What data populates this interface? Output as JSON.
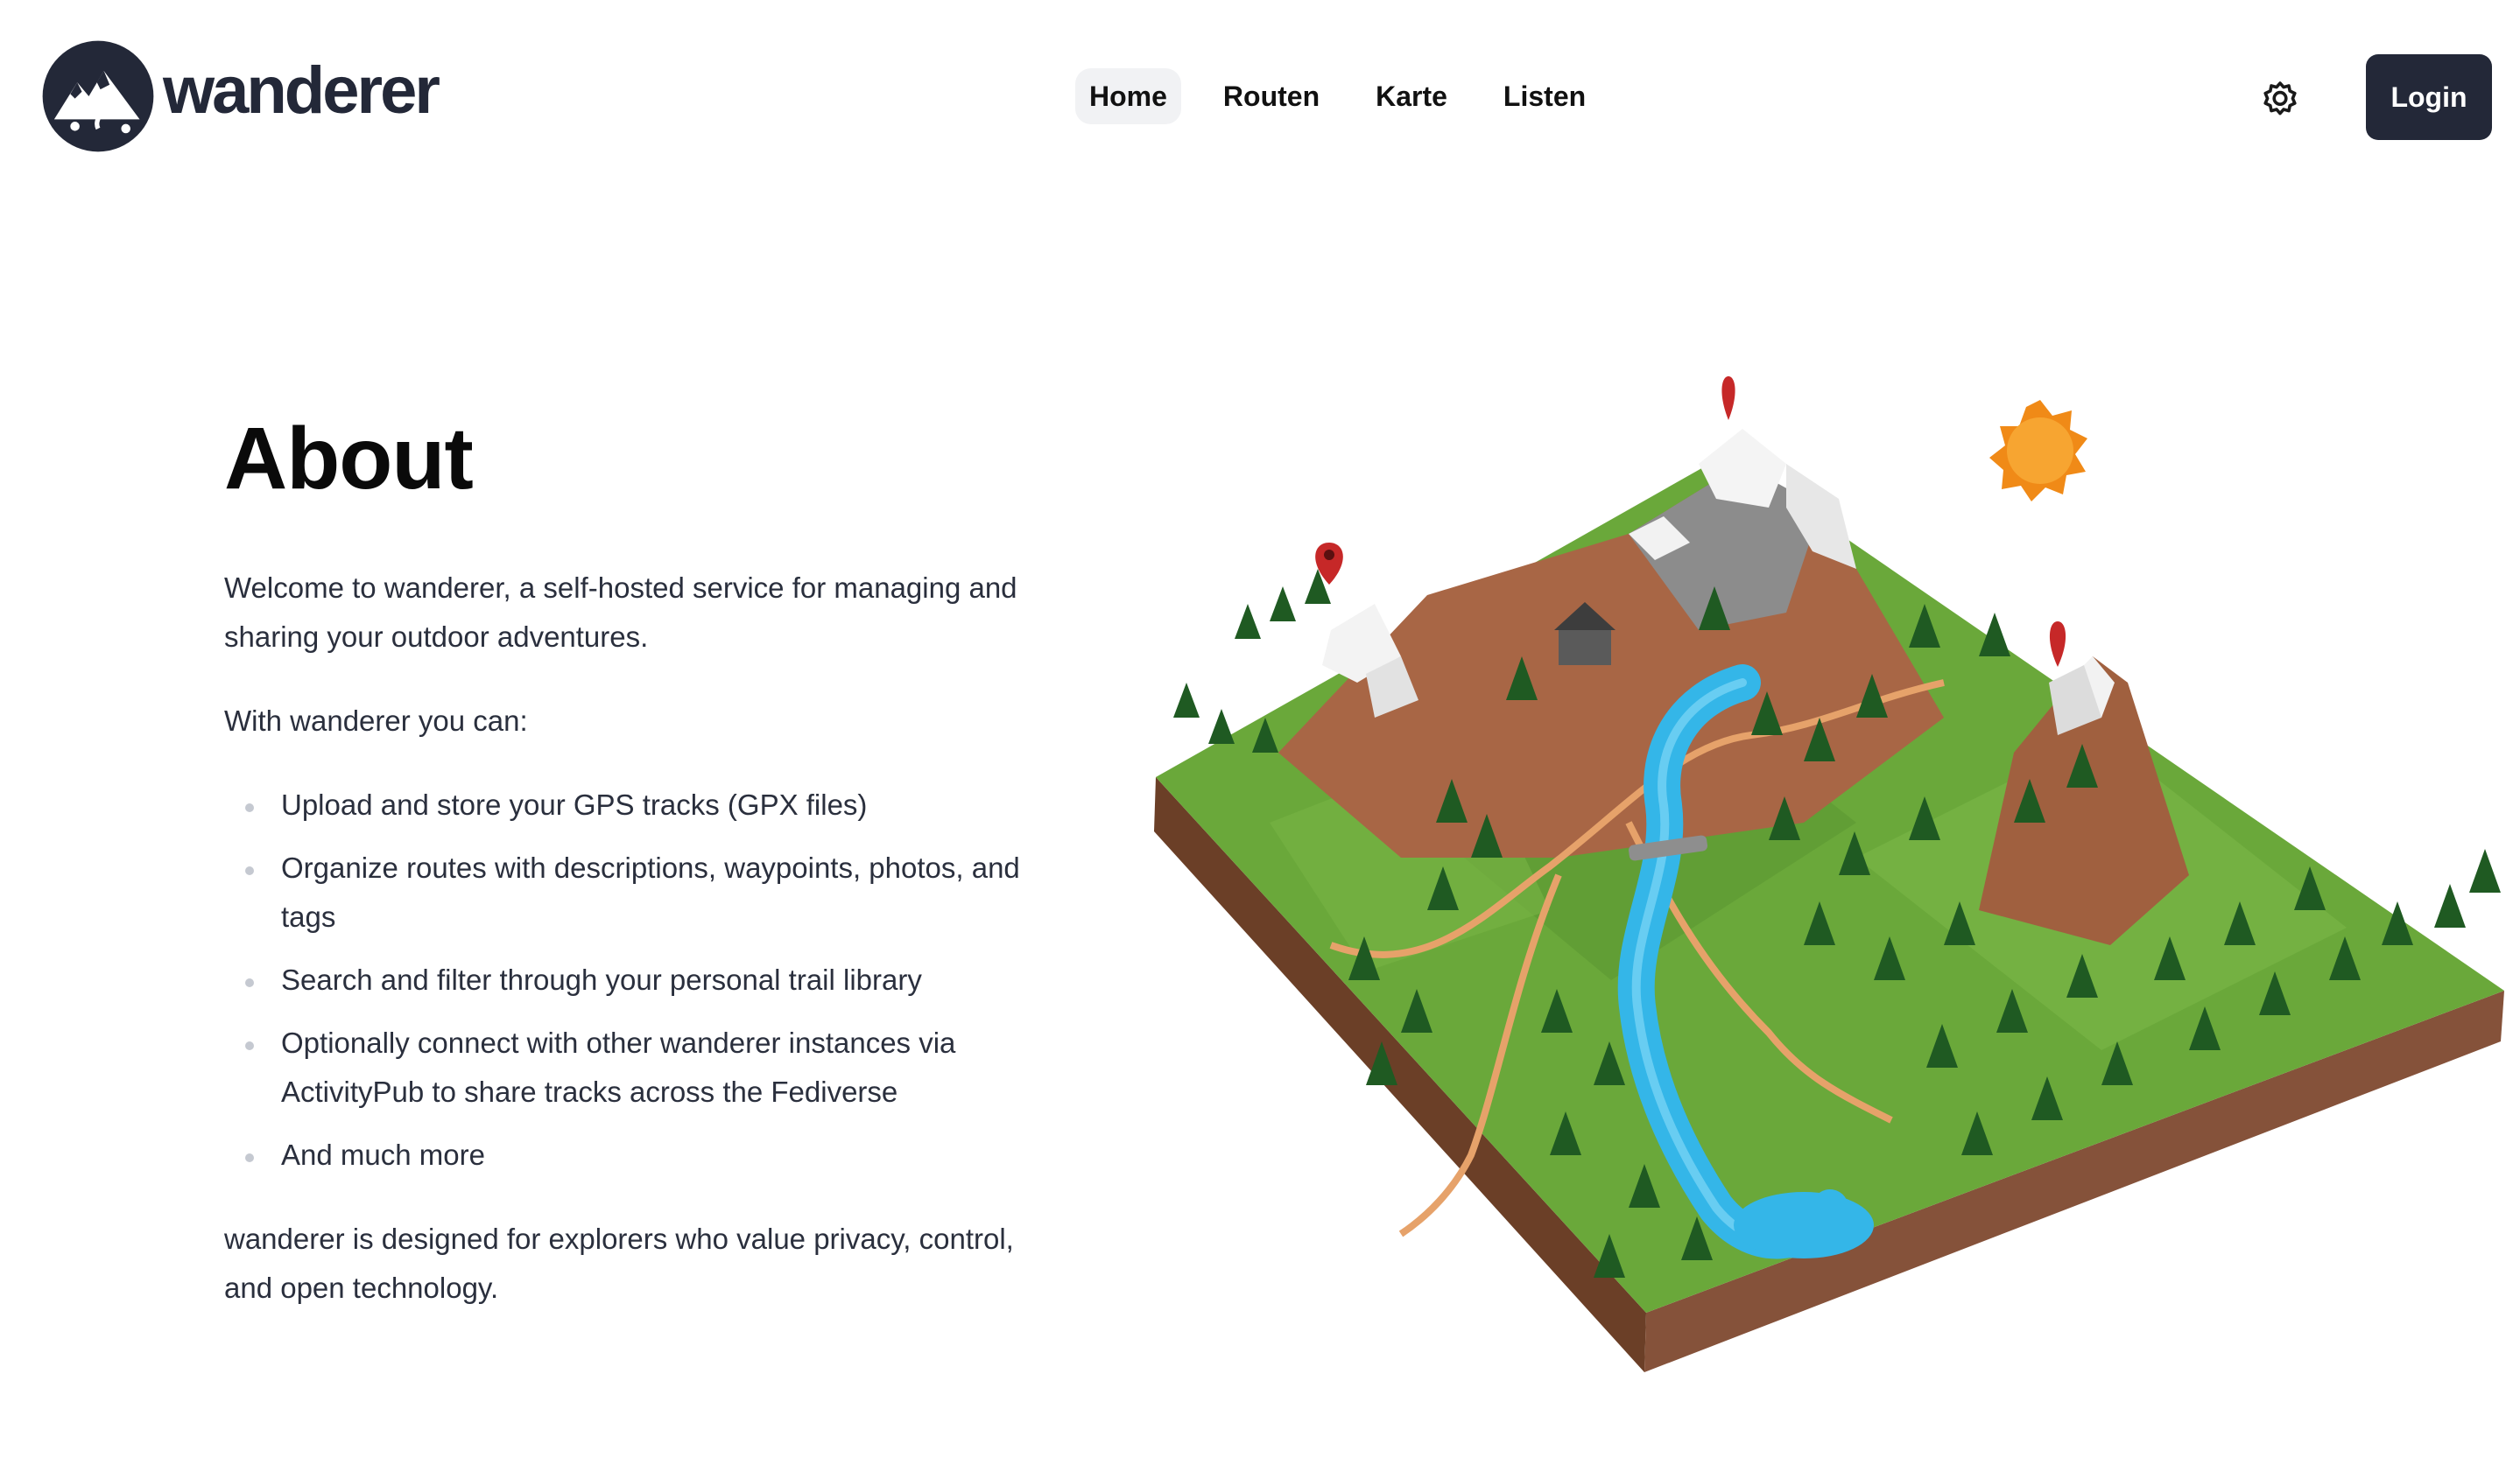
{
  "brand": {
    "name": "wanderer"
  },
  "nav": {
    "items": [
      {
        "label": "Home",
        "active": true
      },
      {
        "label": "Routen",
        "active": false
      },
      {
        "label": "Karte",
        "active": false
      },
      {
        "label": "Listen",
        "active": false
      }
    ]
  },
  "header": {
    "settings_icon": "gear-icon",
    "login_label": "Login"
  },
  "about": {
    "title": "About",
    "intro": "Welcome to wanderer, a self-hosted service for managing and sharing your outdoor adventures.",
    "can_label": "With wanderer you can:",
    "features": [
      "Upload and store your GPS tracks (GPX files)",
      "Organize routes with descriptions, waypoints, photos, and tags",
      "Search and filter through your personal trail library",
      "Optionally connect with other wanderer instances via ActivityPub to share tracks across the Fediverse",
      "And much more"
    ],
    "closing": "wanderer is designed for explorers who value privacy, control, and open technology."
  },
  "colors": {
    "brand_dark": "#232838",
    "nav_active_bg": "#f1f2f4",
    "grass": "#6aa83a",
    "water": "#34b6e8",
    "soil": "#7a4a2e",
    "sun": "#f39a1f",
    "marker": "#c62828"
  }
}
